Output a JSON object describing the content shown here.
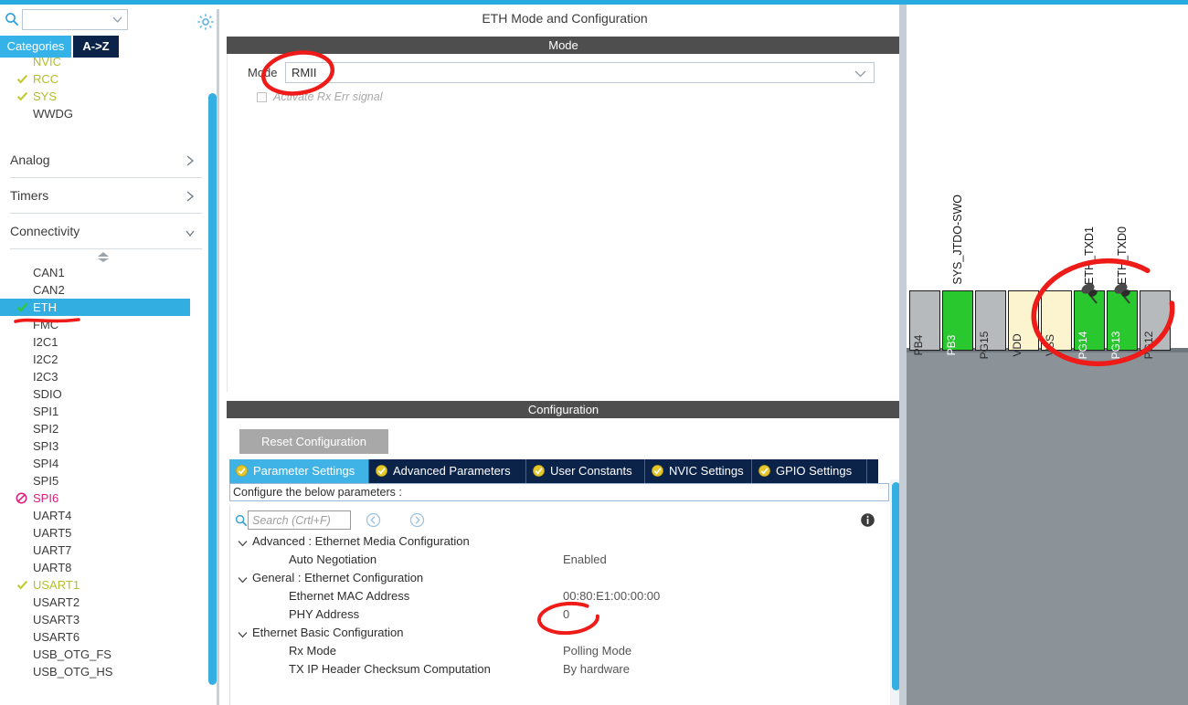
{
  "sidebar": {
    "search": {
      "placeholder": "",
      "value": "",
      "icon": "search-icon"
    },
    "gear_icon": "gear-icon",
    "tabs": {
      "categories": "Categories",
      "a_to_z": "A->Z"
    },
    "top_items": [
      {
        "label": "NVIC",
        "state": "configured",
        "clipped": true
      },
      {
        "label": "RCC",
        "state": "configured"
      },
      {
        "label": "SYS",
        "state": "configured"
      },
      {
        "label": "WWDG",
        "state": "none"
      }
    ],
    "categories": [
      {
        "label": "Analog",
        "expanded": false
      },
      {
        "label": "Timers",
        "expanded": false
      },
      {
        "label": "Connectivity",
        "expanded": true
      }
    ],
    "connectivity_items": [
      {
        "label": "CAN1",
        "state": "none"
      },
      {
        "label": "CAN2",
        "state": "none"
      },
      {
        "label": "ETH",
        "state": "configured",
        "selected": true
      },
      {
        "label": "FMC",
        "state": "none"
      },
      {
        "label": "I2C1",
        "state": "none"
      },
      {
        "label": "I2C2",
        "state": "none"
      },
      {
        "label": "I2C3",
        "state": "none"
      },
      {
        "label": "SDIO",
        "state": "none"
      },
      {
        "label": "SPI1",
        "state": "none"
      },
      {
        "label": "SPI2",
        "state": "none"
      },
      {
        "label": "SPI3",
        "state": "none"
      },
      {
        "label": "SPI4",
        "state": "none"
      },
      {
        "label": "SPI5",
        "state": "none"
      },
      {
        "label": "SPI6",
        "state": "unavailable"
      },
      {
        "label": "UART4",
        "state": "none"
      },
      {
        "label": "UART5",
        "state": "none"
      },
      {
        "label": "UART7",
        "state": "none"
      },
      {
        "label": "UART8",
        "state": "none"
      },
      {
        "label": "USART1",
        "state": "configured"
      },
      {
        "label": "USART2",
        "state": "none"
      },
      {
        "label": "USART3",
        "state": "none"
      },
      {
        "label": "USART6",
        "state": "none"
      },
      {
        "label": "USB_OTG_FS",
        "state": "none"
      },
      {
        "label": "USB_OTG_HS",
        "state": "none"
      }
    ]
  },
  "center": {
    "panel_title": "ETH Mode and Configuration",
    "mode_section": {
      "header": "Mode",
      "mode_label": "Mode",
      "mode_value": "RMII",
      "checkbox_label": "Activate Rx Err signal",
      "checkbox_checked": false,
      "checkbox_disabled": true
    },
    "config_section": {
      "header": "Configuration",
      "reset_button": "Reset Configuration",
      "tabs": [
        {
          "label": "Parameter Settings",
          "active": true
        },
        {
          "label": "Advanced Parameters",
          "active": false
        },
        {
          "label": "User Constants",
          "active": false
        },
        {
          "label": "NVIC Settings",
          "active": false
        },
        {
          "label": "GPIO Settings",
          "active": false
        }
      ],
      "note": "Configure the below parameters :",
      "search_placeholder": "Search (Crtl+F)",
      "search_value": "",
      "parameter_tree": [
        {
          "type": "group",
          "label": "Advanced : Ethernet Media Configuration",
          "expanded": true,
          "children": [
            {
              "name": "Auto Negotiation",
              "value": "Enabled"
            }
          ]
        },
        {
          "type": "group",
          "label": "General : Ethernet Configuration",
          "expanded": true,
          "children": [
            {
              "name": "Ethernet MAC Address",
              "value": "00:80:E1:00:00:00"
            },
            {
              "name": "PHY Address",
              "value": "0"
            }
          ]
        },
        {
          "type": "group",
          "label": "Ethernet Basic Configuration",
          "expanded": true,
          "children": [
            {
              "name": "Rx Mode",
              "value": "Polling Mode"
            },
            {
              "name": "TX IP Header Checksum Computation",
              "value": "By hardware"
            }
          ]
        }
      ]
    }
  },
  "chip": {
    "pins": [
      {
        "label": "PB4",
        "kind": "gray",
        "signal": "",
        "pinned": false
      },
      {
        "label": "PB3",
        "kind": "green",
        "signal": "SYS_JTDO-SWO",
        "pinned": false
      },
      {
        "label": "PG15",
        "kind": "gray",
        "signal": "",
        "pinned": false
      },
      {
        "label": "VDD",
        "kind": "pwr",
        "signal": "",
        "pinned": false
      },
      {
        "label": "VSS",
        "kind": "pwr",
        "signal": "",
        "pinned": false
      },
      {
        "label": "PG14",
        "kind": "green",
        "signal": "ETH_TXD1",
        "pinned": true
      },
      {
        "label": "PG13",
        "kind": "green",
        "signal": "ETH_TXD0",
        "pinned": true
      },
      {
        "label": "PG12",
        "kind": "gray",
        "signal": "",
        "pinned": false
      }
    ]
  },
  "annotations": {
    "color": "#ee1b18",
    "marks": [
      {
        "name": "mode-value-circle",
        "target": "RMII"
      },
      {
        "name": "eth-underline",
        "target": "ETH"
      },
      {
        "name": "phy-address-circle",
        "target": "0"
      },
      {
        "name": "eth-pins-circle",
        "target": "PG14 / PG13"
      }
    ]
  },
  "colors": {
    "accent_blue": "#35aee2",
    "tab_navy": "#0b2249",
    "bar_dark": "#4e4e4e",
    "pin_green": "#28c82e",
    "pin_gray": "#b6babd",
    "pin_power": "#fcf3cf",
    "annotation_red": "#ee1b18",
    "configured_olive": "#b5bd2a"
  }
}
